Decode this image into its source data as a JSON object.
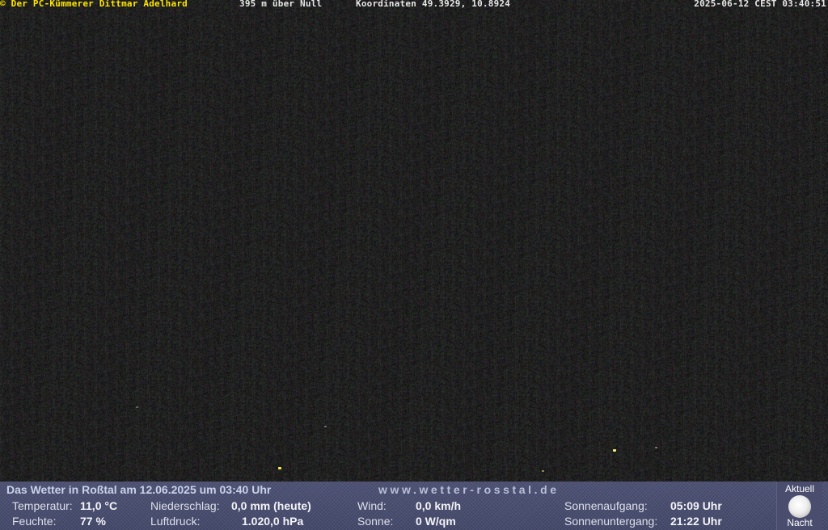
{
  "overlay": {
    "credit": "© Der PC-Kümmerer Dittmar Adelhard",
    "altitude": "395 m über Null",
    "coordinates": "Koordinaten 49.3929, 10.8924",
    "timestamp": "2025-06-12 CEST 03:40:51"
  },
  "panel": {
    "headline": "Das Wetter in Roßtal am 12.06.2025 um 03:40 Uhr",
    "website": "www.wetter-rosstal.de",
    "temperature": {
      "label": "Temperatur:",
      "value": "11,0 °C"
    },
    "humidity": {
      "label": "Feuchte:",
      "value": "77 %"
    },
    "precipitation": {
      "label": "Niederschlag:",
      "value": "0,0 mm (heute)"
    },
    "pressure": {
      "label": "Luftdruck:",
      "value": "1.020,0 hPa"
    },
    "wind": {
      "label": "Wind:",
      "value": "0,0 km/h"
    },
    "sun": {
      "label": "Sonne:",
      "value": "0 W/qm"
    },
    "sunrise": {
      "label": "Sonnenaufgang:",
      "value": "05:09 Uhr"
    },
    "sunset": {
      "label": "Sonnenuntergang:",
      "value": "21:22 Uhr"
    },
    "moon": {
      "top_label": "Aktuell",
      "icon": "full-moon-icon",
      "bottom_label": "Nacht"
    }
  },
  "colors": {
    "credit_yellow": "#ffe600",
    "panel_bg": "#4f5376",
    "headline": "#c9d3ea"
  }
}
